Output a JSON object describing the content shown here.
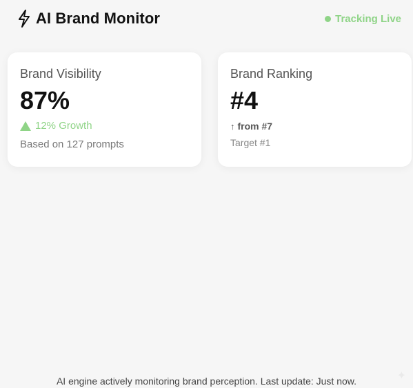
{
  "header": {
    "title": "AI Brand Monitor",
    "status_label": "Tracking Live",
    "status_color": "#8fd487",
    "icon": "lightning-bolt-icon"
  },
  "cards": {
    "visibility": {
      "label": "Brand Visibility",
      "value": "87%",
      "growth": "12% Growth",
      "growth_icon": "triangle-up-icon",
      "note": "Based on 127 prompts"
    },
    "ranking": {
      "label": "Brand Ranking",
      "value": "#4",
      "change_arrow": "↑",
      "change_text": "from #7",
      "target": "Target #1"
    }
  },
  "footer": {
    "text": "AI engine actively monitoring brand perception. Last update: Just now."
  },
  "colors": {
    "accent_green": "#8fd487",
    "background": "#f6f6f6",
    "card": "#ffffff"
  }
}
